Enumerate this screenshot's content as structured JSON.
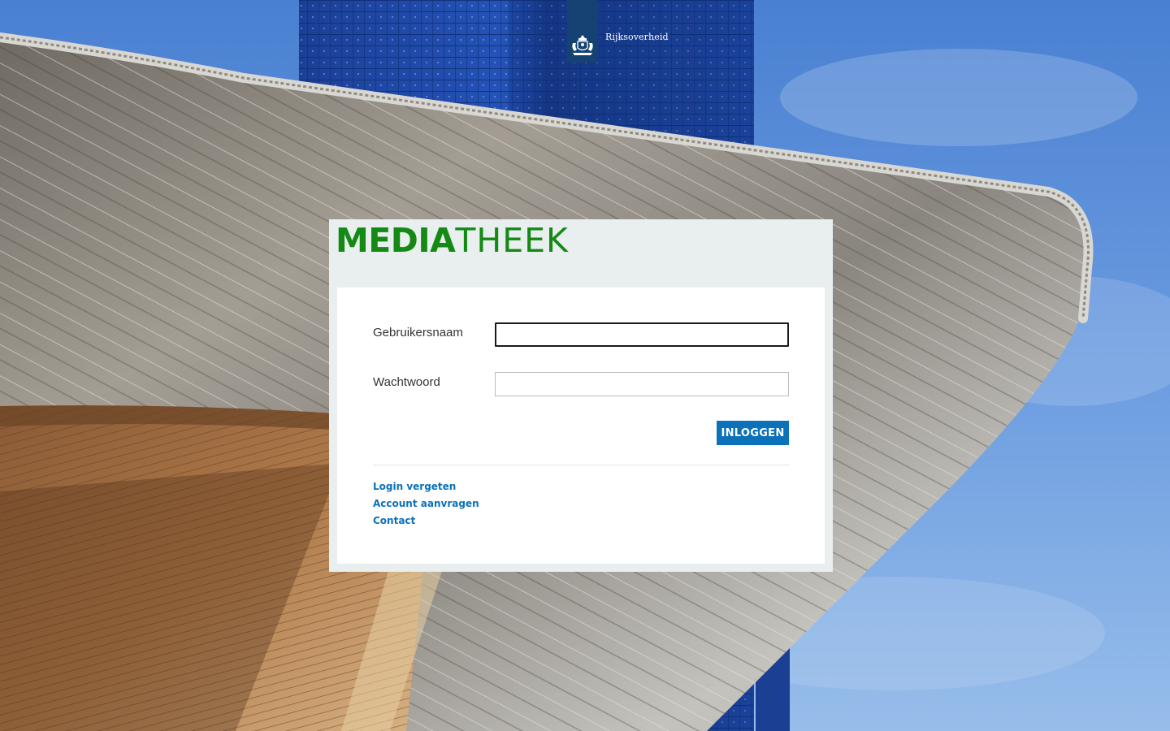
{
  "header": {
    "logo_text": "Rijksoverheid",
    "logo_icon": "rijksoverheid-emblem-icon"
  },
  "brand": {
    "bold": "MEDIA",
    "light": "THEEK",
    "color": "#148a14"
  },
  "form": {
    "username_label": "Gebruikersnaam",
    "username_value": "",
    "password_label": "Wachtwoord",
    "password_value": "",
    "submit_label": "INLOGGEN"
  },
  "links": {
    "forgot": "Login vergeten",
    "request": "Account aanvragen",
    "contact": "Contact"
  },
  "colors": {
    "accent": "#0b71b9",
    "logo_strip": "#154273",
    "panel": "#e9eeef"
  }
}
